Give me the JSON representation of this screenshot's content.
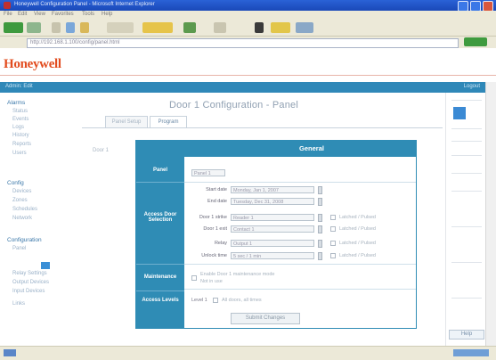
{
  "browser": {
    "window_title": "Honeywell Configuration Panel - Microsoft Internet Explorer",
    "menu": [
      "File",
      "Edit",
      "View",
      "Favorites",
      "Tools",
      "Help"
    ],
    "address": "http://192.168.1.100/config/panel.html"
  },
  "brand": {
    "logo_text": "Honeywell"
  },
  "navbar": {
    "left_text": "Admin: Edit",
    "right_text": "Logout"
  },
  "sidebar": {
    "sections": [
      {
        "heading": "Alarms",
        "items": [
          "Status",
          "Events",
          "Logs",
          "History",
          "Reports",
          "Users"
        ]
      },
      {
        "heading": "Config",
        "items": [
          "Devices",
          "Zones",
          "Schedules",
          "Network"
        ]
      },
      {
        "heading": "Configuration",
        "items": [
          "Panel",
          "",
          "Relay Settings",
          "Output Devices",
          "Input Devices",
          "Links"
        ]
      }
    ]
  },
  "main": {
    "heading": "Door 1 Configuration - Panel",
    "tabs": [
      "Panel Setup",
      "Program"
    ],
    "left_label": "Door 1"
  },
  "dialog": {
    "title": "General",
    "sections": [
      "Panel",
      "Access Door Selection",
      "Maintenance",
      "Access Levels"
    ],
    "panel_value": "Panel 1",
    "fields": [
      {
        "label": "Start date",
        "value": "Monday, Jan 1, 2007",
        "checkbox": ""
      },
      {
        "label": "End date",
        "value": "Tuesday, Dec 31, 2008",
        "checkbox": ""
      },
      {
        "label": "Door 1 strike",
        "value": "Reader 1",
        "checkbox": "Latched / Pulsed"
      },
      {
        "label": "Door 1 exit",
        "value": "Contact 1",
        "checkbox": "Latched / Pulsed"
      },
      {
        "label": "Relay",
        "value": "Output 1",
        "checkbox": "Latched / Pulsed"
      },
      {
        "label": "Unlock time",
        "value": "5 sec / 1 min",
        "checkbox": "Latched / Pulsed"
      }
    ],
    "maintenance_text": "Enable Door 1 maintenance mode",
    "maintenance_note": "Not in use",
    "access_label": "Level 1",
    "access_text": "All doors, all times",
    "submit_label": "Submit Changes"
  },
  "right_panel": {
    "button_label": "Help"
  },
  "colors": {
    "accent": "#2f8cb5",
    "brand": "#e24c1f"
  }
}
